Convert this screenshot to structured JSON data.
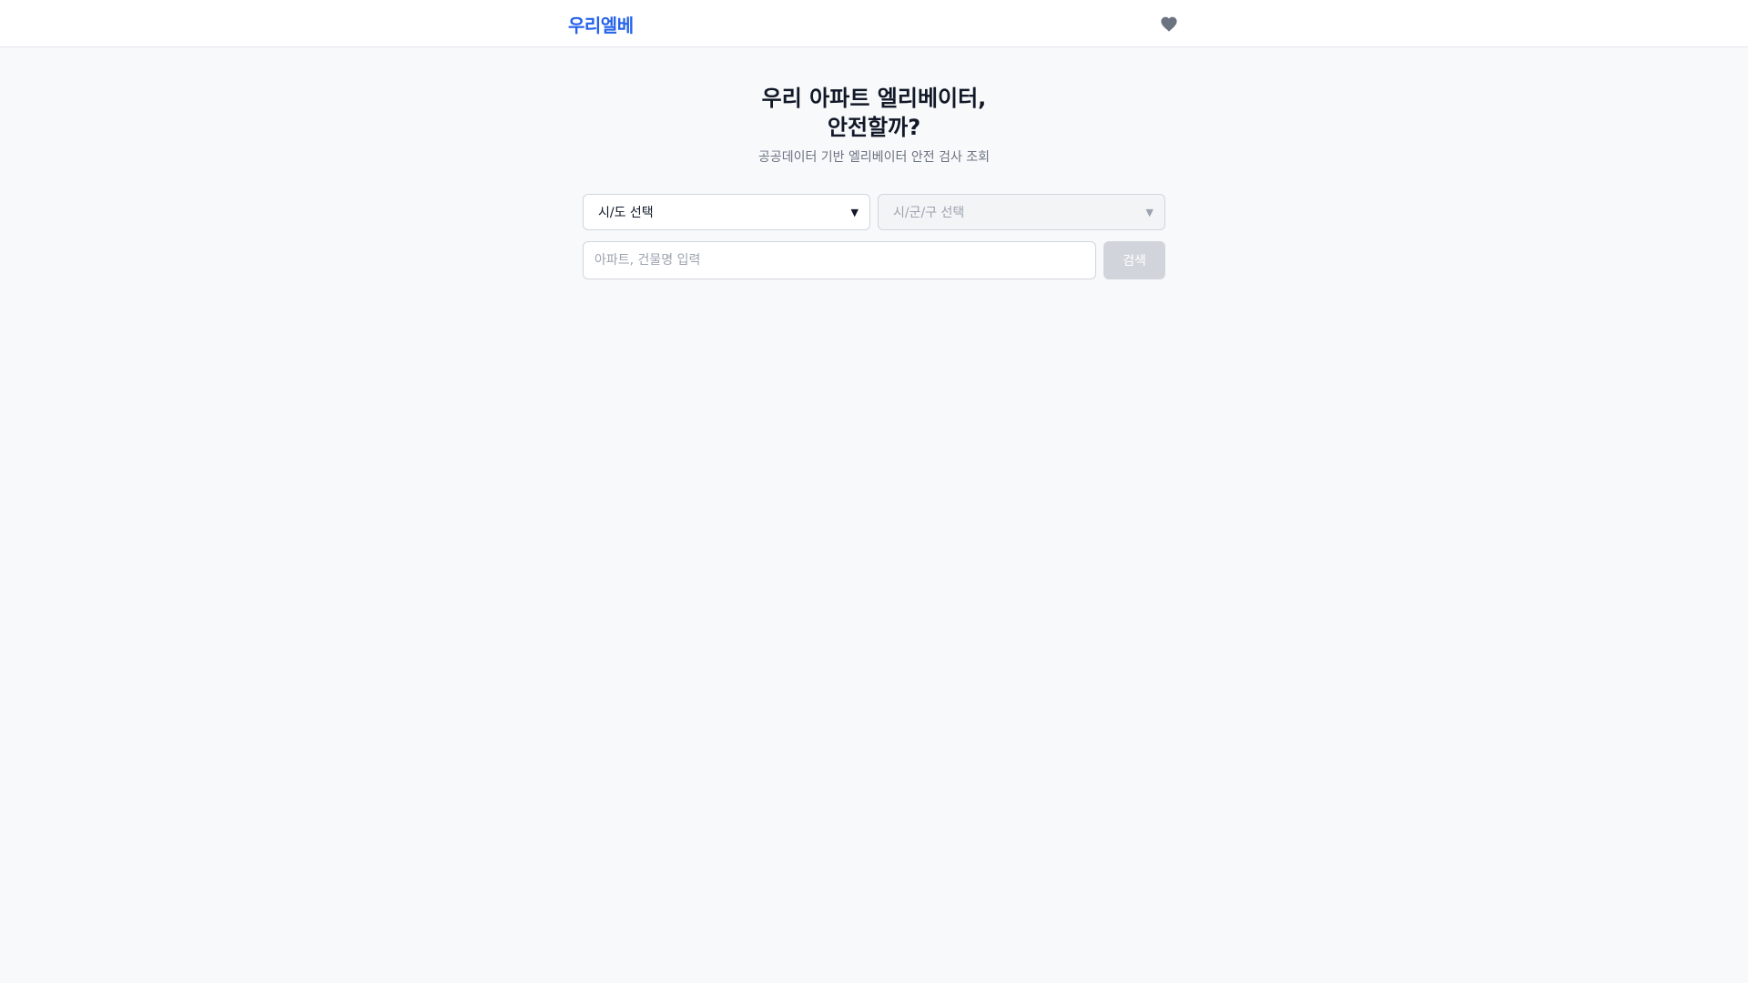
{
  "header": {
    "logo": "우리엘베",
    "favorites_icon": "heart-icon"
  },
  "hero": {
    "title_line1": "우리 아파트 엘리베이터,",
    "title_line2": "안전할까?",
    "subtitle": "공공데이터 기반 엘리베이터 안전 검사 조회"
  },
  "search": {
    "region_select": "시/도 선택",
    "district_select": "시/군/구 선택",
    "input_placeholder": "아파트, 건물명 입력",
    "button_label": "검색"
  },
  "colors": {
    "brand": "#2563eb",
    "background": "#f8f9fb",
    "disabled_button": "#d1d5db"
  }
}
